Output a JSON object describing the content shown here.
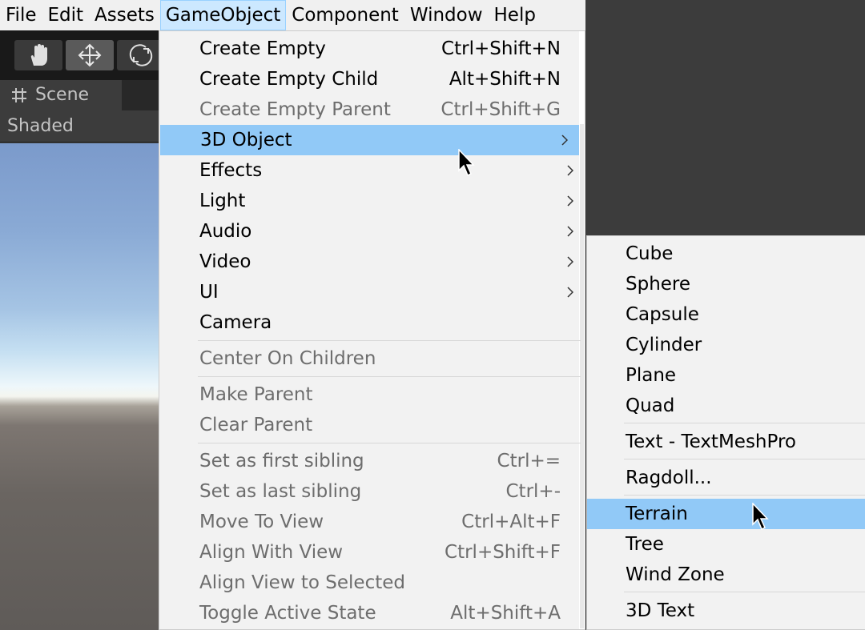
{
  "menubar": {
    "items": [
      {
        "label": "File",
        "active": false
      },
      {
        "label": "Edit",
        "active": false
      },
      {
        "label": "Assets",
        "active": false
      },
      {
        "label": "GameObject",
        "active": true
      },
      {
        "label": "Component",
        "active": false
      },
      {
        "label": "Window",
        "active": false
      },
      {
        "label": "Help",
        "active": false
      }
    ]
  },
  "editor": {
    "tools": [
      "hand-tool-icon",
      "move-tool-icon",
      "rotate-tool-icon"
    ],
    "selected_tool": "move-tool-icon",
    "scene_tab_label": "Scene",
    "shading_mode": "Shaded"
  },
  "gameobject_menu": {
    "items": [
      {
        "label": "Create Empty",
        "shortcut": "Ctrl+Shift+N",
        "enabled": true
      },
      {
        "label": "Create Empty Child",
        "shortcut": "Alt+Shift+N",
        "enabled": true
      },
      {
        "label": "Create Empty Parent",
        "shortcut": "Ctrl+Shift+G",
        "enabled": false
      },
      {
        "label": "3D Object",
        "submenu": true,
        "enabled": true,
        "highlighted": true
      },
      {
        "label": "Effects",
        "submenu": true,
        "enabled": true
      },
      {
        "label": "Light",
        "submenu": true,
        "enabled": true
      },
      {
        "label": "Audio",
        "submenu": true,
        "enabled": true
      },
      {
        "label": "Video",
        "submenu": true,
        "enabled": true
      },
      {
        "label": "UI",
        "submenu": true,
        "enabled": true
      },
      {
        "label": "Camera",
        "enabled": true
      },
      {
        "label": "Center On Children",
        "enabled": false
      },
      {
        "label": "Make Parent",
        "enabled": false
      },
      {
        "label": "Clear Parent",
        "enabled": false
      },
      {
        "label": "Set as first sibling",
        "shortcut": "Ctrl+=",
        "enabled": false
      },
      {
        "label": "Set as last sibling",
        "shortcut": "Ctrl+-",
        "enabled": false
      },
      {
        "label": "Move To View",
        "shortcut": "Ctrl+Alt+F",
        "enabled": false
      },
      {
        "label": "Align With View",
        "shortcut": "Ctrl+Shift+F",
        "enabled": false
      },
      {
        "label": "Align View to Selected",
        "enabled": false
      },
      {
        "label": "Toggle Active State",
        "shortcut": "Alt+Shift+A",
        "enabled": false
      }
    ]
  },
  "object3d_submenu": {
    "items": [
      {
        "label": "Cube"
      },
      {
        "label": "Sphere"
      },
      {
        "label": "Capsule"
      },
      {
        "label": "Cylinder"
      },
      {
        "label": "Plane"
      },
      {
        "label": "Quad"
      },
      {
        "label": "Text - TextMeshPro"
      },
      {
        "label": "Ragdoll..."
      },
      {
        "label": "Terrain",
        "highlighted": true
      },
      {
        "label": "Tree"
      },
      {
        "label": "Wind Zone"
      },
      {
        "label": "3D Text"
      }
    ]
  },
  "colors": {
    "menu_bg": "#f2f2f2",
    "highlight": "#91c9f7",
    "menubar_active": "#cce8ff",
    "disabled_text": "#6d6d6d",
    "editor_dark": "#191919"
  }
}
